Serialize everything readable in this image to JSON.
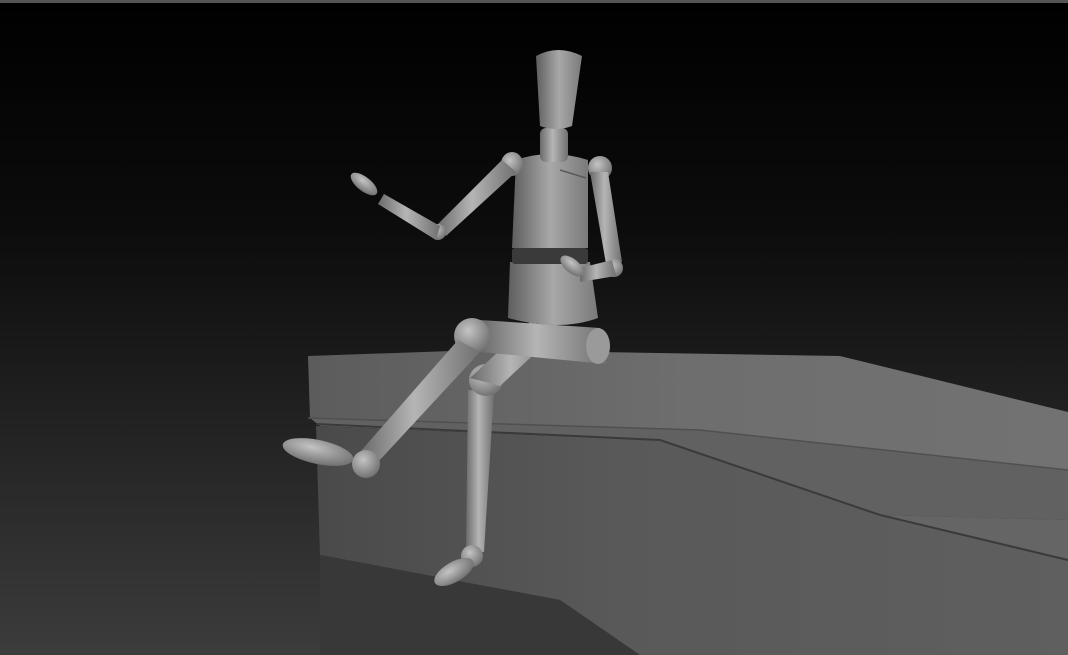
{
  "scene": {
    "subject": "wooden-mannequin",
    "prop": "ledge-block",
    "render_style": "clay-grey-matcap"
  },
  "colors": {
    "background_top": "#000000",
    "background_bottom": "#3c3c3c",
    "mannequin_base": "#8e8e8e",
    "mannequin_light": "#b9b9b9",
    "mannequin_dark": "#5a5a5a",
    "belt": "#3a3a3a",
    "ledge_top": "#6a6a6a",
    "ledge_front": "#545454",
    "ledge_shadow": "#3e3e3e"
  }
}
